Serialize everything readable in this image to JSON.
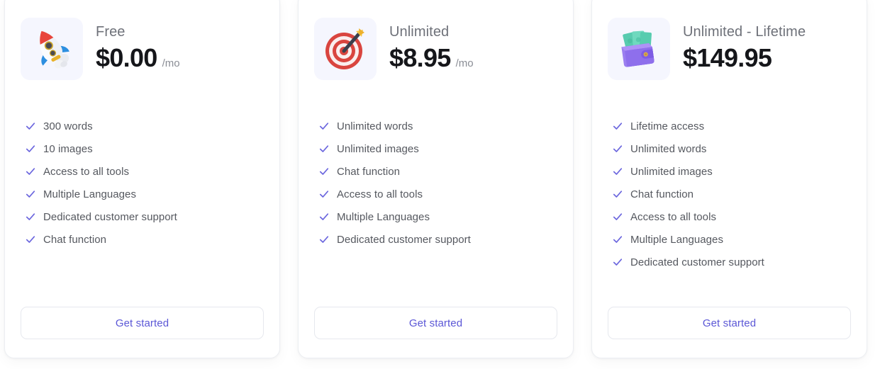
{
  "theme": {
    "page_background": "#ffffff",
    "card_background": "#ffffff",
    "card_border": "#eceef2",
    "icon_tile_background": "#f5f6fe",
    "accent": "#5b57d6",
    "check_color": "#6b66de",
    "price_color": "#15161a",
    "plan_name_color": "#6e7179",
    "feature_text_color": "#55585f",
    "period_color": "#8a8d95"
  },
  "plans": [
    {
      "icon": "rocket-icon",
      "name": "Free",
      "price": "$0.00",
      "period": "/mo",
      "features": [
        "300 words",
        "10 images",
        "Access to all tools",
        "Multiple Languages",
        "Dedicated customer support",
        "Chat function"
      ],
      "cta_label": "Get started"
    },
    {
      "icon": "target-icon",
      "name": "Unlimited",
      "price": "$8.95",
      "period": "/mo",
      "features": [
        "Unlimited words",
        "Unlimited images",
        "Chat function",
        "Access to all tools",
        "Multiple Languages",
        "Dedicated customer support"
      ],
      "cta_label": "Get started"
    },
    {
      "icon": "wallet-icon",
      "name": "Unlimited - Lifetime",
      "price": "$149.95",
      "period": "",
      "features": [
        "Lifetime access",
        "Unlimited words",
        "Unlimited images",
        "Chat function",
        "Access to all tools",
        "Multiple Languages",
        "Dedicated customer support"
      ],
      "cta_label": "Get started"
    }
  ]
}
